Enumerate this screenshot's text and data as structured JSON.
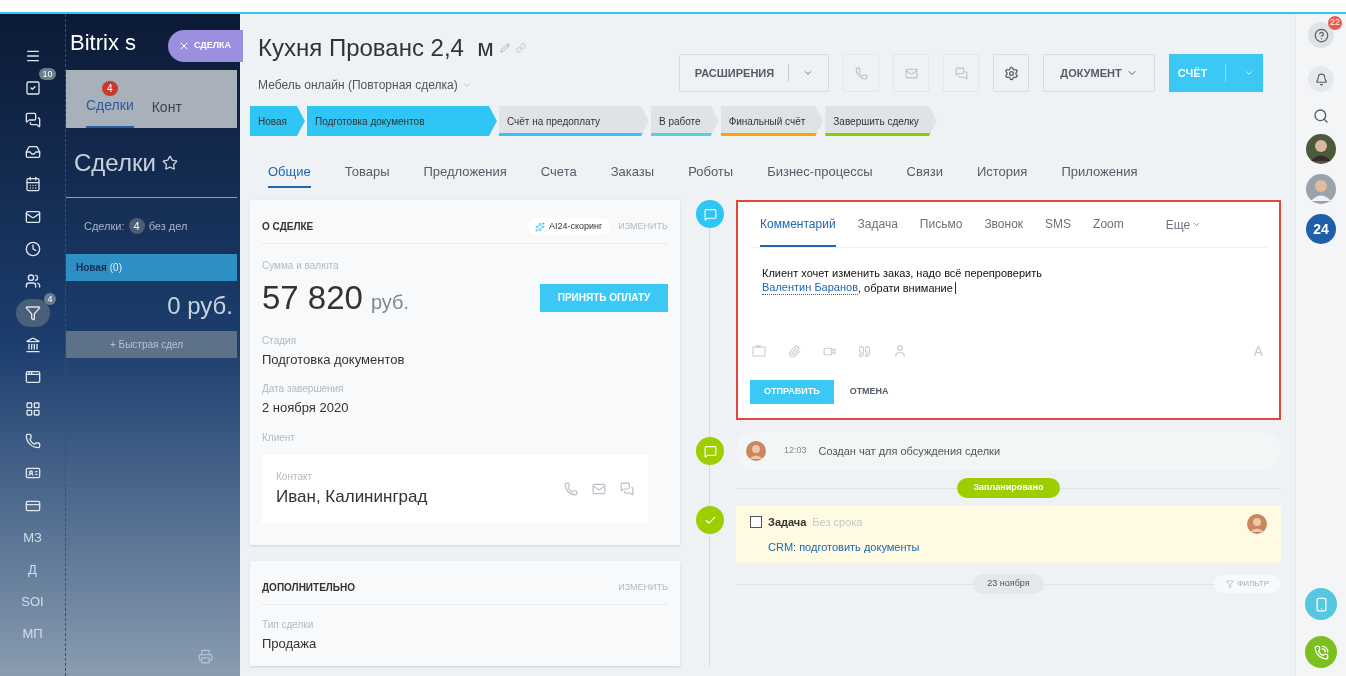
{
  "left_menu": {
    "items": [
      {
        "kind": "icon",
        "selected": false
      },
      {
        "kind": "icon",
        "badge": "10",
        "selected": false
      },
      {
        "kind": "icon",
        "selected": false
      },
      {
        "kind": "icon",
        "selected": false
      },
      {
        "kind": "icon",
        "selected": false
      },
      {
        "kind": "icon",
        "selected": false
      },
      {
        "kind": "icon",
        "selected": false
      },
      {
        "kind": "icon",
        "selected": false
      },
      {
        "kind": "icon",
        "badge": "4",
        "selected": true
      },
      {
        "kind": "icon",
        "selected": false
      },
      {
        "kind": "icon",
        "selected": false
      },
      {
        "kind": "icon",
        "selected": false
      },
      {
        "kind": "icon",
        "selected": false
      },
      {
        "kind": "icon",
        "selected": false
      },
      {
        "kind": "icon",
        "selected": false
      },
      {
        "kind": "text",
        "label": "МЗ",
        "selected": false
      },
      {
        "kind": "text",
        "label": "Д",
        "selected": false
      },
      {
        "kind": "text",
        "label": "SOI",
        "selected": false
      },
      {
        "kind": "text",
        "label": "МП",
        "selected": false
      }
    ]
  },
  "list_panel": {
    "app_title": "Bitrix s",
    "slider_tab": "СДЕЛКА",
    "tabs": [
      {
        "label": "Сделки",
        "badge": "4",
        "selected": true
      },
      {
        "label": "Конт",
        "selected": false
      }
    ],
    "title": "Сделки",
    "counter": {
      "label": "Сделки:",
      "count": "4",
      "suffix": "без дел"
    },
    "column": {
      "name": "Новая",
      "count": "(0)",
      "sum": "0 руб.",
      "quick_add": "+ Быстрая сдел"
    }
  },
  "deal": {
    "title": "Кухня Прованс 2,4  м",
    "subtitle": "Мебель онлайн (Повторная сделка)",
    "toolbar": {
      "extensions": "РАСШИРЕНИЯ",
      "document": "ДОКУМЕНТ",
      "invoice": "СЧЁТ"
    },
    "stages": [
      {
        "label": "Новая",
        "reached": true
      },
      {
        "label": "Подготовка документов",
        "reached": true
      },
      {
        "label": "Счёт на предоплату",
        "reached": false,
        "color": "#2fc6f6"
      },
      {
        "label": "В работе",
        "reached": false,
        "color": "#55d0e0"
      },
      {
        "label": "Финальный счёт",
        "reached": false,
        "color": "#f7a700"
      },
      {
        "label": "Завершить сделку",
        "reached": false,
        "color": "#7bd500"
      }
    ],
    "tabs": [
      {
        "label": "Общие",
        "selected": true
      },
      {
        "label": "Товары",
        "selected": false
      },
      {
        "label": "Предложения",
        "selected": false
      },
      {
        "label": "Счета",
        "selected": false
      },
      {
        "label": "Заказы",
        "selected": false
      },
      {
        "label": "Роботы",
        "selected": false
      },
      {
        "label": "Бизнес-процессы",
        "selected": false
      },
      {
        "label": "Связи",
        "selected": false
      },
      {
        "label": "История",
        "selected": false
      },
      {
        "label": "Приложения",
        "selected": false
      }
    ],
    "about": {
      "heading": "О СДЕЛКЕ",
      "scoring": "AI24-скоринг",
      "edit": "ИЗМЕНИТЬ",
      "amount_label": "Сумма и валюта",
      "amount": "57 820",
      "currency": "руб.",
      "pay_button": "ПРИНЯТЬ ОПЛАТУ",
      "stage_label": "Стадия",
      "stage": "Подготовка документов",
      "date_label": "Дата завершения",
      "date": "2 ноября 2020",
      "client_label": "Клиент",
      "contact_label": "Контакт",
      "contact": "Иван, Калининград"
    },
    "extra": {
      "heading": "ДОПОЛНИТЕЛЬНО",
      "edit": "ИЗМЕНИТЬ",
      "type_label": "Тип сделки",
      "type": "Продажа"
    },
    "editor": {
      "tabs": [
        {
          "label": "Комментарий",
          "selected": true
        },
        {
          "label": "Задача",
          "selected": false
        },
        {
          "label": "Письмо",
          "selected": false
        },
        {
          "label": "Звонок",
          "selected": false
        },
        {
          "label": "SMS",
          "selected": false
        },
        {
          "label": "Zoom",
          "selected": false
        }
      ],
      "more": "Еще",
      "line1": "Клиент хочет изменить заказ, надо всё перепроверить",
      "mention": "Валентин Баранов",
      "line2_rest": ", обрати внимание",
      "font_button": "A",
      "send": "ОТПРАВИТЬ",
      "cancel": "ОТМЕНА"
    },
    "timeline": {
      "chat": {
        "time": "12:03",
        "text": "Создан чат для обсуждения сделки"
      },
      "planned": "Запланировано",
      "task": {
        "title": "Задача",
        "deadline": "Без срока",
        "checked": false,
        "link": "CRM: подготовить документы"
      },
      "date": "23 ноября",
      "filter": "ФИЛЬТР"
    }
  },
  "right_bar": {
    "help_badge": "22",
    "counter": "24"
  }
}
